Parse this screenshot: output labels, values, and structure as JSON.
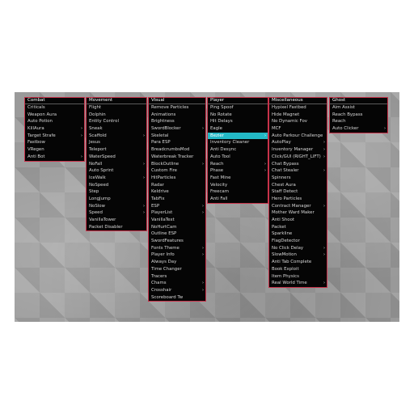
{
  "colors": {
    "panel_bg": "#050505",
    "panel_border": "#c8324a",
    "highlight": "#23b9c6",
    "text": "#d8d8d8"
  },
  "panels": [
    {
      "title": "Combat",
      "items": [
        {
          "label": "Criticals",
          "sub": false
        },
        {
          "label": "Weapon Aura",
          "sub": false
        },
        {
          "label": "Auto Potion",
          "sub": false
        },
        {
          "label": "KillAura",
          "sub": true
        },
        {
          "label": "Target Strafe",
          "sub": true
        },
        {
          "label": "Fastbow",
          "sub": false
        },
        {
          "label": "VRegen",
          "sub": false
        },
        {
          "label": "Anti Bot",
          "sub": true
        }
      ]
    },
    {
      "title": "Movement",
      "items": [
        {
          "label": "Flight",
          "sub": false
        },
        {
          "label": "Dolphin",
          "sub": false
        },
        {
          "label": "Entity Control",
          "sub": false
        },
        {
          "label": "Sneak",
          "sub": false
        },
        {
          "label": "Scaffold",
          "sub": true
        },
        {
          "label": "Jesus",
          "sub": false
        },
        {
          "label": "Teleport",
          "sub": false
        },
        {
          "label": "WaterSpeed",
          "sub": false
        },
        {
          "label": "NoFall",
          "sub": true
        },
        {
          "label": "Auto Sprint",
          "sub": false
        },
        {
          "label": "IceWalk",
          "sub": true
        },
        {
          "label": "NoSpeed",
          "sub": false
        },
        {
          "label": "Step",
          "sub": false
        },
        {
          "label": "LongJump",
          "sub": false
        },
        {
          "label": "NoSlow",
          "sub": true
        },
        {
          "label": "Speed",
          "sub": true
        },
        {
          "label": "VanillaTower",
          "sub": false
        },
        {
          "label": "Packet Disabler",
          "sub": false
        }
      ]
    },
    {
      "title": "Visual",
      "items": [
        {
          "label": "Remove Particles",
          "sub": false
        },
        {
          "label": "Animations",
          "sub": false
        },
        {
          "label": "Brightness",
          "sub": false
        },
        {
          "label": "SwordBlocker",
          "sub": true
        },
        {
          "label": "Skeletal",
          "sub": false
        },
        {
          "label": "Para ESP",
          "sub": false
        },
        {
          "label": "BreadcrumbsMod",
          "sub": false
        },
        {
          "label": "Waterbreak Tracker",
          "sub": false
        },
        {
          "label": "BlockOutline",
          "sub": true
        },
        {
          "label": "Custom Fire",
          "sub": false
        },
        {
          "label": "HitParticles",
          "sub": false
        },
        {
          "label": "Radar",
          "sub": false
        },
        {
          "label": "Keldrive",
          "sub": false
        },
        {
          "label": "TabFix",
          "sub": false
        },
        {
          "label": "ESP",
          "sub": true
        },
        {
          "label": "PlayerList",
          "sub": true
        },
        {
          "label": "VanillaText",
          "sub": false
        },
        {
          "label": "NoHurtCam",
          "sub": false
        },
        {
          "label": "Outline ESP",
          "sub": false
        },
        {
          "label": "SwordFeatures",
          "sub": false
        },
        {
          "label": "Fonts Theme",
          "sub": true
        },
        {
          "label": "Player Info",
          "sub": true
        },
        {
          "label": "Always Day",
          "sub": false
        },
        {
          "label": "Time Changer",
          "sub": false
        },
        {
          "label": "Tracers",
          "sub": false
        },
        {
          "label": "Chams",
          "sub": true
        },
        {
          "label": "Crosshair",
          "sub": true
        },
        {
          "label": "Scoreboard Tw",
          "sub": false
        }
      ]
    },
    {
      "title": "Player",
      "items": [
        {
          "label": "Ping Spoof",
          "sub": false
        },
        {
          "label": "No Rotate",
          "sub": false
        },
        {
          "label": "Hit Delays",
          "sub": false
        },
        {
          "label": "Eagle",
          "sub": false
        },
        {
          "label": "Bezier",
          "sub": true,
          "active": true
        },
        {
          "label": "Inventory Cleaner",
          "sub": false
        },
        {
          "label": "Anti Desync",
          "sub": false
        },
        {
          "label": "Auto Tool",
          "sub": false
        },
        {
          "label": "Reach",
          "sub": true
        },
        {
          "label": "Phase",
          "sub": true
        },
        {
          "label": "Fast Mine",
          "sub": false
        },
        {
          "label": "Velocity",
          "sub": false
        },
        {
          "label": "Freecam",
          "sub": false
        },
        {
          "label": "Anti Fall",
          "sub": false
        }
      ]
    },
    {
      "title": "Miscellaneous",
      "items": [
        {
          "label": "Hypixel Fastbed",
          "sub": false
        },
        {
          "label": "Hide Magnet",
          "sub": false
        },
        {
          "label": "No Dynamic Fov",
          "sub": false
        },
        {
          "label": "MCF",
          "sub": false
        },
        {
          "label": "Auto Parkour Challenge",
          "sub": false
        },
        {
          "label": "AutoPlay",
          "sub": true
        },
        {
          "label": "Inventory Manager",
          "sub": true
        },
        {
          "label": "Click/GUI (RIGHT_LIFT)",
          "sub": true
        },
        {
          "label": "Chat Bypass",
          "sub": false
        },
        {
          "label": "Chat Stealer",
          "sub": true
        },
        {
          "label": "Spinners",
          "sub": false
        },
        {
          "label": "Chest Aura",
          "sub": false
        },
        {
          "label": "Staff Detect",
          "sub": false
        },
        {
          "label": "Hero Particles",
          "sub": false
        },
        {
          "label": "Contract Manager",
          "sub": true
        },
        {
          "label": "Mother Ward Maker",
          "sub": false
        },
        {
          "label": "Anti Shoot",
          "sub": false
        },
        {
          "label": "Packet",
          "sub": false
        },
        {
          "label": "Sparkline",
          "sub": false
        },
        {
          "label": "FlagDetector",
          "sub": false
        },
        {
          "label": "No Click Delay",
          "sub": true
        },
        {
          "label": "SlowMotion",
          "sub": true
        },
        {
          "label": "Anti Tab Complete",
          "sub": false
        },
        {
          "label": "Book Exploit",
          "sub": false
        },
        {
          "label": "Item Physics",
          "sub": false
        },
        {
          "label": "Real World Time",
          "sub": true
        }
      ]
    },
    {
      "title": "Ghost",
      "items": [
        {
          "label": "Aim Assist",
          "sub": false
        },
        {
          "label": "Reach Bypass",
          "sub": false
        },
        {
          "label": "Reach",
          "sub": false
        },
        {
          "label": "Auto Clicker",
          "sub": true
        }
      ]
    }
  ]
}
